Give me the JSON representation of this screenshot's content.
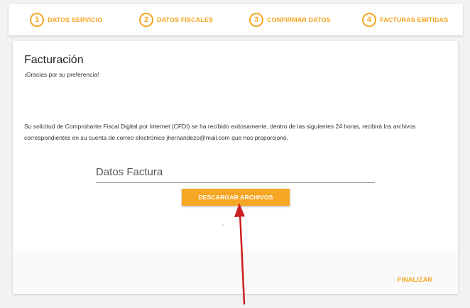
{
  "stepper": {
    "steps": [
      {
        "number": "1",
        "label": "DATOS SERVICIO"
      },
      {
        "number": "2",
        "label": "DATOS FISCALES"
      },
      {
        "number": "3",
        "label": "CONFIRMAR DATOS"
      },
      {
        "number": "4",
        "label": "FACTURAS EMITIDAS"
      }
    ]
  },
  "card": {
    "title": "Facturación",
    "subtitle": "¡Gracias por su preferencia!",
    "message": "Su solicitud de Comprobante Fiscal Digital por Internet (CFDI) se ha recibido exitosamente, dentro de las siguientes 24 horas, recibirá los archivos correspondientes en su cuenta de correo electrónico jhernandezo@mail.com que nos proporcionó.",
    "field_label": "Datos Factura",
    "download_label": "DESCARGAR ARCHIVOS",
    "finish_label": "FINALIZAR"
  },
  "colors": {
    "accent": "#f5a623",
    "arrow": "#cc1f1f"
  },
  "icons": {
    "annotation": "red-arrow-icon"
  }
}
